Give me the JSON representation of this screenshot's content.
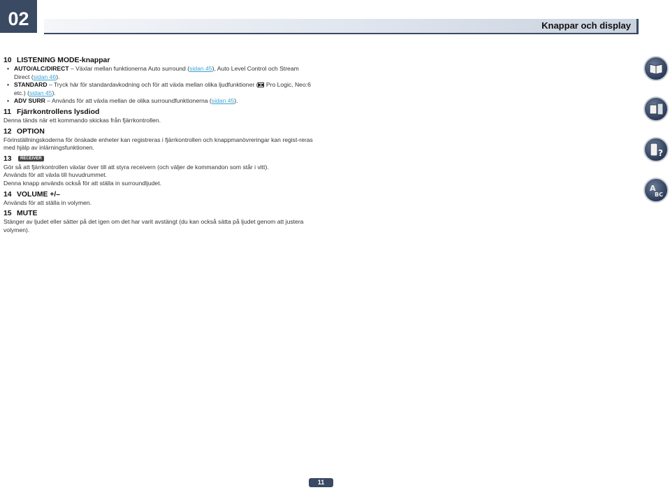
{
  "chapter": "02",
  "header_title": "Knappar och display",
  "sections": {
    "s10": {
      "num": "10",
      "title": "LISTENING MODE-knappar"
    },
    "s11": {
      "num": "11",
      "title": "Fjärrkontrollens lysdiod",
      "text": "Denna tänds när ett kommando skickas från fjärrkontrollen."
    },
    "s12": {
      "num": "12",
      "title": "OPTION",
      "text": "Förinställningskoderna för önskade enheter kan registreras i fjärrkontrollen och knappmanövreringar kan regist-reras med hjälp av inlärningsfunktionen."
    },
    "s13": {
      "num": "13",
      "tag": "RECEIVER",
      "line1": "Gör så att fjärrkontrollen växlar över till att styra receivern (och väljer de kommandon som står i vitt).",
      "line2": "Används för att växla till huvudrummet.",
      "line3": "Denna knapp används också för att ställa in surroundljudet."
    },
    "s14": {
      "num": "14",
      "title": "VOLUME +/–",
      "text": "Används för att ställa in volymen."
    },
    "s15": {
      "num": "15",
      "title": "MUTE",
      "text": "Stänger av ljudet eller sätter på det igen om det har varit avstängt (du kan också sätta på ljudet genom att justera volymen)."
    }
  },
  "bullets": {
    "b1": {
      "label": "AUTO/ALC/DIRECT",
      "text1": " – Växlar mellan funktionerna Auto surround (",
      "link1": "sidan 45",
      "text2": "), Auto Level Control och Stream Direct (",
      "link2": "sidan 46",
      "text3": ")."
    },
    "b2": {
      "label": "STANDARD",
      "text1": " – Tryck här för standardavkodning och för att växla mellan olika ljudfunktioner (",
      "text2": " Pro Logic, Neo:6 etc.) (",
      "link1": "sidan 45",
      "text3": ")."
    },
    "b3": {
      "label": "ADV SURR",
      "text1": " – Används för att växla mellan de olika surroundfunktionerna (",
      "link1": "sidan 45",
      "text2": ")."
    }
  },
  "page_number": "11",
  "side_icons": [
    "book-icon",
    "receiver-icon",
    "remote-help-icon",
    "abc-icon"
  ]
}
